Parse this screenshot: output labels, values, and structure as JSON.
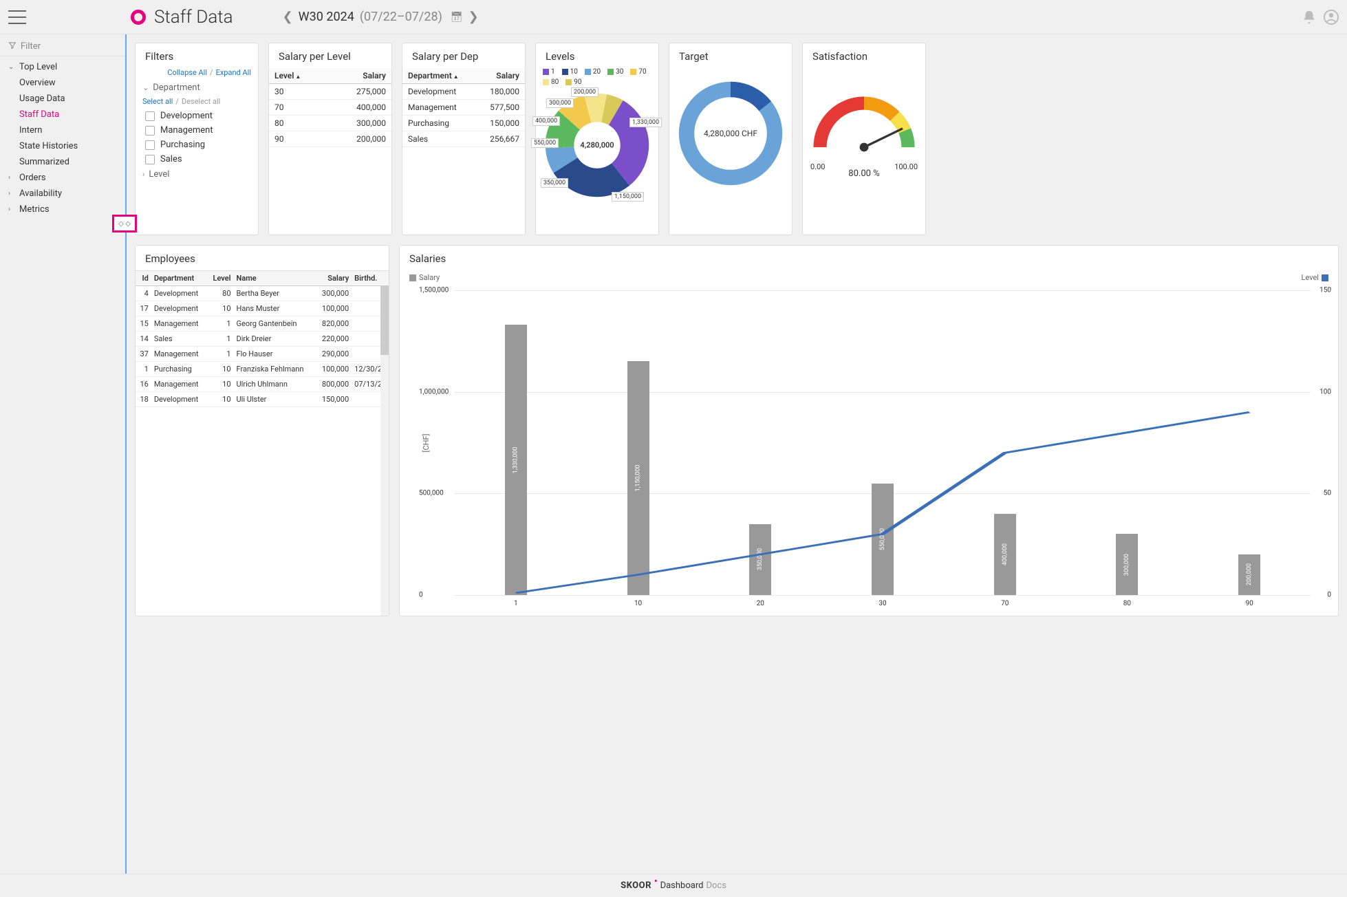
{
  "header": {
    "page_title": "Staff Data",
    "week": "W30 2024",
    "range": "(07/22–07/28)"
  },
  "sidebar": {
    "filter_label": "Filter",
    "items": [
      {
        "label": "Top Level",
        "expanded": true,
        "children": [
          {
            "label": "Overview"
          },
          {
            "label": "Usage Data"
          },
          {
            "label": "Staff Data",
            "active": true
          },
          {
            "label": "Intern"
          },
          {
            "label": "State Histories"
          },
          {
            "label": "Summarized"
          }
        ]
      },
      {
        "label": "Orders",
        "expanded": false
      },
      {
        "label": "Availability",
        "expanded": false
      },
      {
        "label": "Metrics",
        "expanded": false
      }
    ]
  },
  "filters": {
    "title": "Filters",
    "collapse_all": "Collapse All",
    "expand_all": "Expand All",
    "group_department": "Department",
    "group_level": "Level",
    "select_all": "Select all",
    "deselect_all": "Deselect all",
    "departments": [
      "Development",
      "Management",
      "Purchasing",
      "Sales"
    ]
  },
  "salary_per_level": {
    "title": "Salary per Level",
    "cols": [
      "Level",
      "Salary"
    ],
    "rows": [
      {
        "level": "30",
        "salary": "275,000"
      },
      {
        "level": "70",
        "salary": "400,000"
      },
      {
        "level": "80",
        "salary": "300,000"
      },
      {
        "level": "90",
        "salary": "200,000"
      }
    ]
  },
  "salary_per_dep": {
    "title": "Salary per Dep",
    "cols": [
      "Department",
      "Salary"
    ],
    "rows": [
      {
        "dep": "Development",
        "salary": "180,000"
      },
      {
        "dep": "Management",
        "salary": "577,500"
      },
      {
        "dep": "Purchasing",
        "salary": "150,000"
      },
      {
        "dep": "Sales",
        "salary": "256,667"
      }
    ]
  },
  "levels": {
    "title": "Levels",
    "legend": [
      {
        "label": "1",
        "color": "#7b4fc9"
      },
      {
        "label": "10",
        "color": "#2b4a8b"
      },
      {
        "label": "20",
        "color": "#6aa3d8"
      },
      {
        "label": "30",
        "color": "#5cb85c"
      },
      {
        "label": "70",
        "color": "#f2c94c"
      },
      {
        "label": "80",
        "color": "#f5e58a"
      },
      {
        "label": "90",
        "color": "#d8c95a"
      }
    ],
    "total": "4,280,000"
  },
  "target": {
    "title": "Target",
    "center": "4,280,000 CHF"
  },
  "satisfaction": {
    "title": "Satisfaction",
    "value": "80.00 %",
    "min": "0.00",
    "max": "100.00"
  },
  "employees": {
    "title": "Employees",
    "cols": [
      "Id",
      "Department",
      "Level",
      "Name",
      "Salary",
      "Birthd."
    ],
    "rows": [
      {
        "id": "4",
        "dep": "Development",
        "level": "80",
        "name": "Bertha Beyer",
        "salary": "300,000",
        "birth": ""
      },
      {
        "id": "17",
        "dep": "Development",
        "level": "10",
        "name": "Hans Muster",
        "salary": "100,000",
        "birth": ""
      },
      {
        "id": "15",
        "dep": "Management",
        "level": "1",
        "name": "Georg Gantenbein",
        "salary": "820,000",
        "birth": ""
      },
      {
        "id": "14",
        "dep": "Sales",
        "level": "1",
        "name": "Dirk Dreier",
        "salary": "220,000",
        "birth": ""
      },
      {
        "id": "37",
        "dep": "Management",
        "level": "1",
        "name": "Flo Hauser",
        "salary": "290,000",
        "birth": ""
      },
      {
        "id": "1",
        "dep": "Purchasing",
        "level": "10",
        "name": "Franziska Fehlmann",
        "salary": "100,000",
        "birth": "12/30/2"
      },
      {
        "id": "16",
        "dep": "Management",
        "level": "10",
        "name": "Ulrich Uhlmann",
        "salary": "800,000",
        "birth": "07/13/2"
      },
      {
        "id": "18",
        "dep": "Development",
        "level": "10",
        "name": "Uli Ulster",
        "salary": "150,000",
        "birth": ""
      }
    ]
  },
  "salaries": {
    "title": "Salaries",
    "legend_left": "Salary",
    "legend_right": "Level",
    "ylabel": "[CHF]"
  },
  "footer": {
    "brand": "SKOOR",
    "sub": "Dashboard",
    "docs": "Docs"
  },
  "chart_data": [
    {
      "type": "pie",
      "title": "Levels",
      "categories": [
        "1",
        "10",
        "20",
        "30",
        "70",
        "80",
        "90"
      ],
      "values": [
        1330000,
        1150000,
        350000,
        550000,
        400000,
        300000,
        200000
      ],
      "total": 4280000,
      "labels": [
        "1,330,000",
        "1,150,000",
        "350,000",
        "550,000",
        "400,000",
        "300,000",
        "200,000"
      ]
    },
    {
      "type": "gauge",
      "title": "Target",
      "value": 4280000,
      "unit": "CHF"
    },
    {
      "type": "gauge",
      "title": "Satisfaction",
      "value": 80.0,
      "min": 0.0,
      "max": 100.0
    },
    {
      "type": "bar+line",
      "title": "Salaries",
      "categories": [
        "1",
        "10",
        "20",
        "30",
        "70",
        "80",
        "90"
      ],
      "series": [
        {
          "name": "Salary",
          "type": "bar",
          "axis": "left",
          "values": [
            1330000,
            1150000,
            350000,
            550000,
            400000,
            300000,
            200000
          ]
        },
        {
          "name": "Level",
          "type": "line",
          "axis": "right",
          "values": [
            1,
            10,
            20,
            30,
            70,
            80,
            90
          ]
        }
      ],
      "xlabel": "",
      "ylabel": "[CHF]",
      "ylim": [
        0,
        1500000
      ],
      "y2lim": [
        0,
        150
      ]
    }
  ]
}
